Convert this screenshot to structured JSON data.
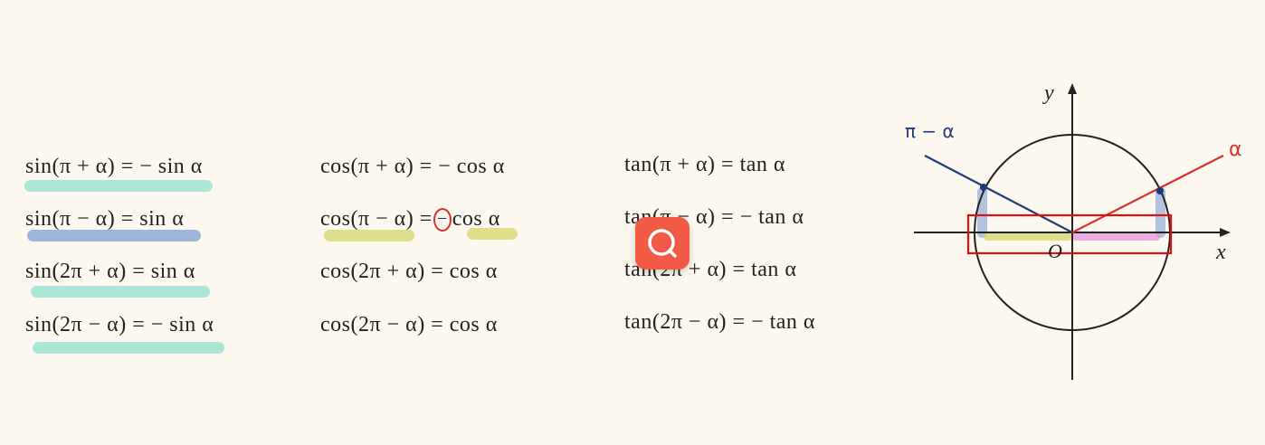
{
  "sin_column": [
    "sin(π + α) = − sin α",
    "sin(π − α) = sin α",
    "sin(2π + α) = sin α",
    "sin(2π − α) = − sin α"
  ],
  "cos_column": [
    "cos(π + α) = − cos α",
    "cos(π − α) =",
    "cos(2π + α) = cos α",
    "cos(2π − α) = cos α"
  ],
  "cos_row2_circled_sign": "−",
  "cos_row2_tail": "cos α",
  "tan_column": [
    "tan(π + α) = tan α",
    "tan(π − α) = − tan α",
    "tan(2π + α) = tan α",
    "tan(2π − α) = − tan α"
  ],
  "diagram": {
    "y_label": "y",
    "x_label": "x",
    "origin_label": "O",
    "label_pi_minus_alpha": "π − α",
    "label_alpha": "α"
  },
  "colors": {
    "background": "#fdf8ef",
    "teal_highlight": "#8fe0cf",
    "blue_highlight": "#7f9fd4",
    "olive_highlight": "#d4d76a",
    "pink_highlight": "#e58fd8",
    "navy_line": "#1f3a7a",
    "red_line": "#d8322a",
    "search_button": "#f15a45",
    "selection_box": "#e01010"
  },
  "icons": {
    "search_button": "search-icon"
  }
}
